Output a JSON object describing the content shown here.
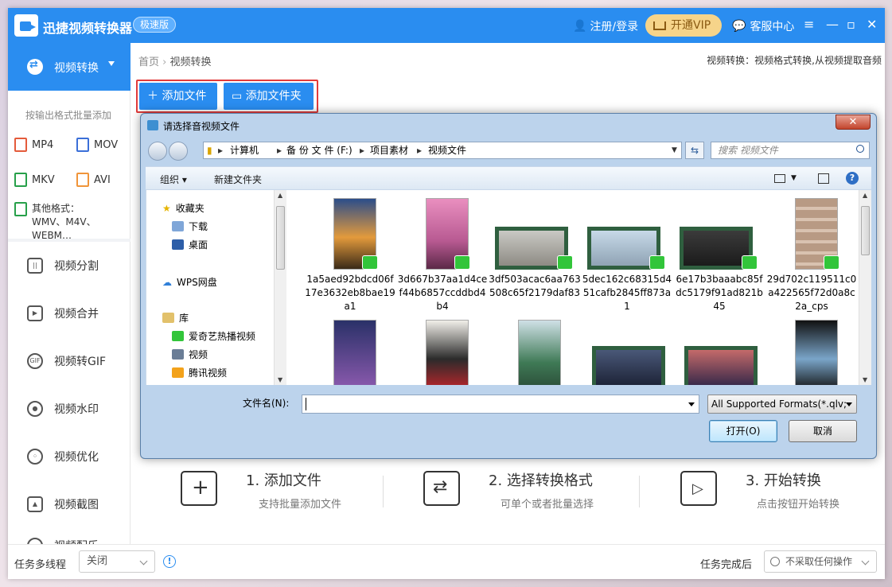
{
  "app": {
    "title": "迅捷视频转换器",
    "badge": "极速版"
  },
  "titlebar": {
    "login": "注册/登录",
    "vip": "开通VIP",
    "service": "客服中心",
    "menu": "≡",
    "minimize": "—",
    "restore": "▫",
    "close": "✕"
  },
  "sidebar": {
    "active": "视频转换",
    "hint": "按输出格式批量添加",
    "formats": [
      "MP4",
      "MOV",
      "MKV",
      "AVI"
    ],
    "other_formats": "其他格式：WMV、M4V、WEBM…",
    "nav": [
      "视频分割",
      "视频合并",
      "视频转GIF",
      "视频水印",
      "视频优化",
      "视频截图",
      "视频配乐"
    ]
  },
  "main": {
    "breadcrumb_home": "首页",
    "breadcrumb_sep": "›",
    "breadcrumb_current": "视频转换",
    "description": "视频转换：视频格式转换,从视频提取音频",
    "add_file": "添加文件",
    "add_folder": "添加文件夹",
    "steps": [
      {
        "title": "1. 添加文件",
        "subtitle": "支持批量添加文件"
      },
      {
        "title": "2. 选择转换格式",
        "subtitle": "可单个或者批量选择"
      },
      {
        "title": "3. 开始转换",
        "subtitle": "点击按钮开始转换"
      }
    ]
  },
  "bottom": {
    "multithread_label": "任务多线程",
    "multithread_value": "关闭",
    "after_label": "任务完成后",
    "after_value": "不采取任何操作"
  },
  "dialog": {
    "title": "请选择音视频文件",
    "path": [
      "计算机",
      "备 份 文 件 (F:)",
      "项目素材",
      "视频文件"
    ],
    "search_placeholder": "搜索 视频文件",
    "organize": "组织 ▾",
    "new_folder": "新建文件夹",
    "tree": {
      "favorites": "收藏夹",
      "downloads": "下载",
      "desktop": "桌面",
      "wps": "WPS网盘",
      "library": "库",
      "iqiyi": "爱奇艺热播视频",
      "videos": "视频",
      "tencent": "腾讯视频"
    },
    "files": [
      "1a5aed92bdcd06f17e3632eb8bae19a1",
      "3d667b37aa1d4cef44b6857ccddbd4b4",
      "3df503acac6aa763508c65f2179daf83",
      "5dec162c68315d451cafb2845ff873a1",
      "6e17b3baaabc85fdc5179f91ad821b45",
      "29d702c119511c0a422565f72d0a8c2a_cps"
    ],
    "filename_label": "文件名(N):",
    "filename_value": "",
    "format_filter": "All Supported Formats(*.qlv;",
    "open": "打开(O)",
    "cancel": "取消"
  },
  "colors": {
    "brand": "#2a8df0",
    "highlight": "#e23b3b",
    "iqiyi": "#32c53a"
  }
}
